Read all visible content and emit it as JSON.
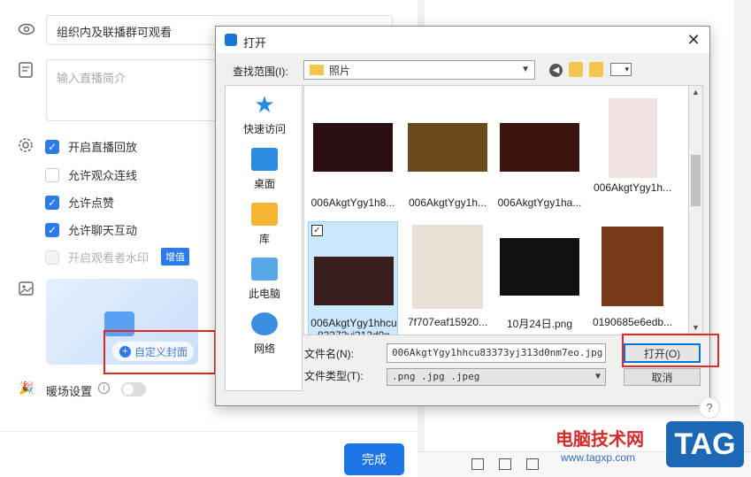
{
  "panel": {
    "visibility_value": "组织内及联播群可观看",
    "desc_placeholder": "输入直播简介",
    "options": [
      {
        "label": "开启直播回放",
        "checked": true,
        "disabled": false
      },
      {
        "label": "允许观众连线",
        "checked": false,
        "disabled": false
      },
      {
        "label": "允许点赞",
        "checked": true,
        "disabled": false
      },
      {
        "label": "允许聊天互动",
        "checked": true,
        "disabled": false
      },
      {
        "label": "开启观看者水印",
        "checked": false,
        "disabled": true
      }
    ],
    "watermark_badge": "增值",
    "custom_cover_label": "自定义封面",
    "warmup_label": "暖场设置",
    "done_button": "完成"
  },
  "dialog": {
    "title": "打开",
    "look_in_label": "查找范围(I):",
    "look_in_value": "照片",
    "sidebar": [
      {
        "label": "快速访问",
        "icon": "star-icon",
        "color": "#2b8be0"
      },
      {
        "label": "桌面",
        "icon": "desktop-icon",
        "color": "#2b8be0"
      },
      {
        "label": "库",
        "icon": "library-icon",
        "color": "#f3b533"
      },
      {
        "label": "此电脑",
        "icon": "computer-icon",
        "color": "#59a7e6"
      },
      {
        "label": "网络",
        "icon": "network-icon",
        "color": "#3b8de0"
      }
    ],
    "files": [
      {
        "name": "006AkgtYgy1h8...",
        "color": "#a8263a"
      },
      {
        "name": "006AkgtYgy1h...",
        "color": "#c58a22"
      },
      {
        "name": "006AkgtYgy1ha...",
        "color": "#5a1d14"
      },
      {
        "name": "006AkgtYgy1h...",
        "color": "#e9d8d8"
      },
      {
        "name": "006AkgtYgy1hhcu83373yj313d0n",
        "color": "#3a1e1c",
        "selected": true
      },
      {
        "name": "7f707eaf15920...",
        "color": "#eadfd5"
      },
      {
        "name": "10月24日.png",
        "color": "#111111"
      },
      {
        "name": "0190685e6edb...",
        "color": "#7a3a1a"
      }
    ],
    "filename_label": "文件名(N):",
    "filename_value": "006AkgtYgy1hhcu83373yj313d0nm7eo.jpg",
    "filetype_label": "文件类型(T):",
    "filetype_value": ".png .jpg .jpeg",
    "open_button": "打开(O)",
    "cancel_button": "取消",
    "close_glyph": "✕"
  },
  "watermark": {
    "site_name": "电脑技术网",
    "url": "www.tagxp.com",
    "tag": "TAG"
  },
  "help_glyph": "?"
}
